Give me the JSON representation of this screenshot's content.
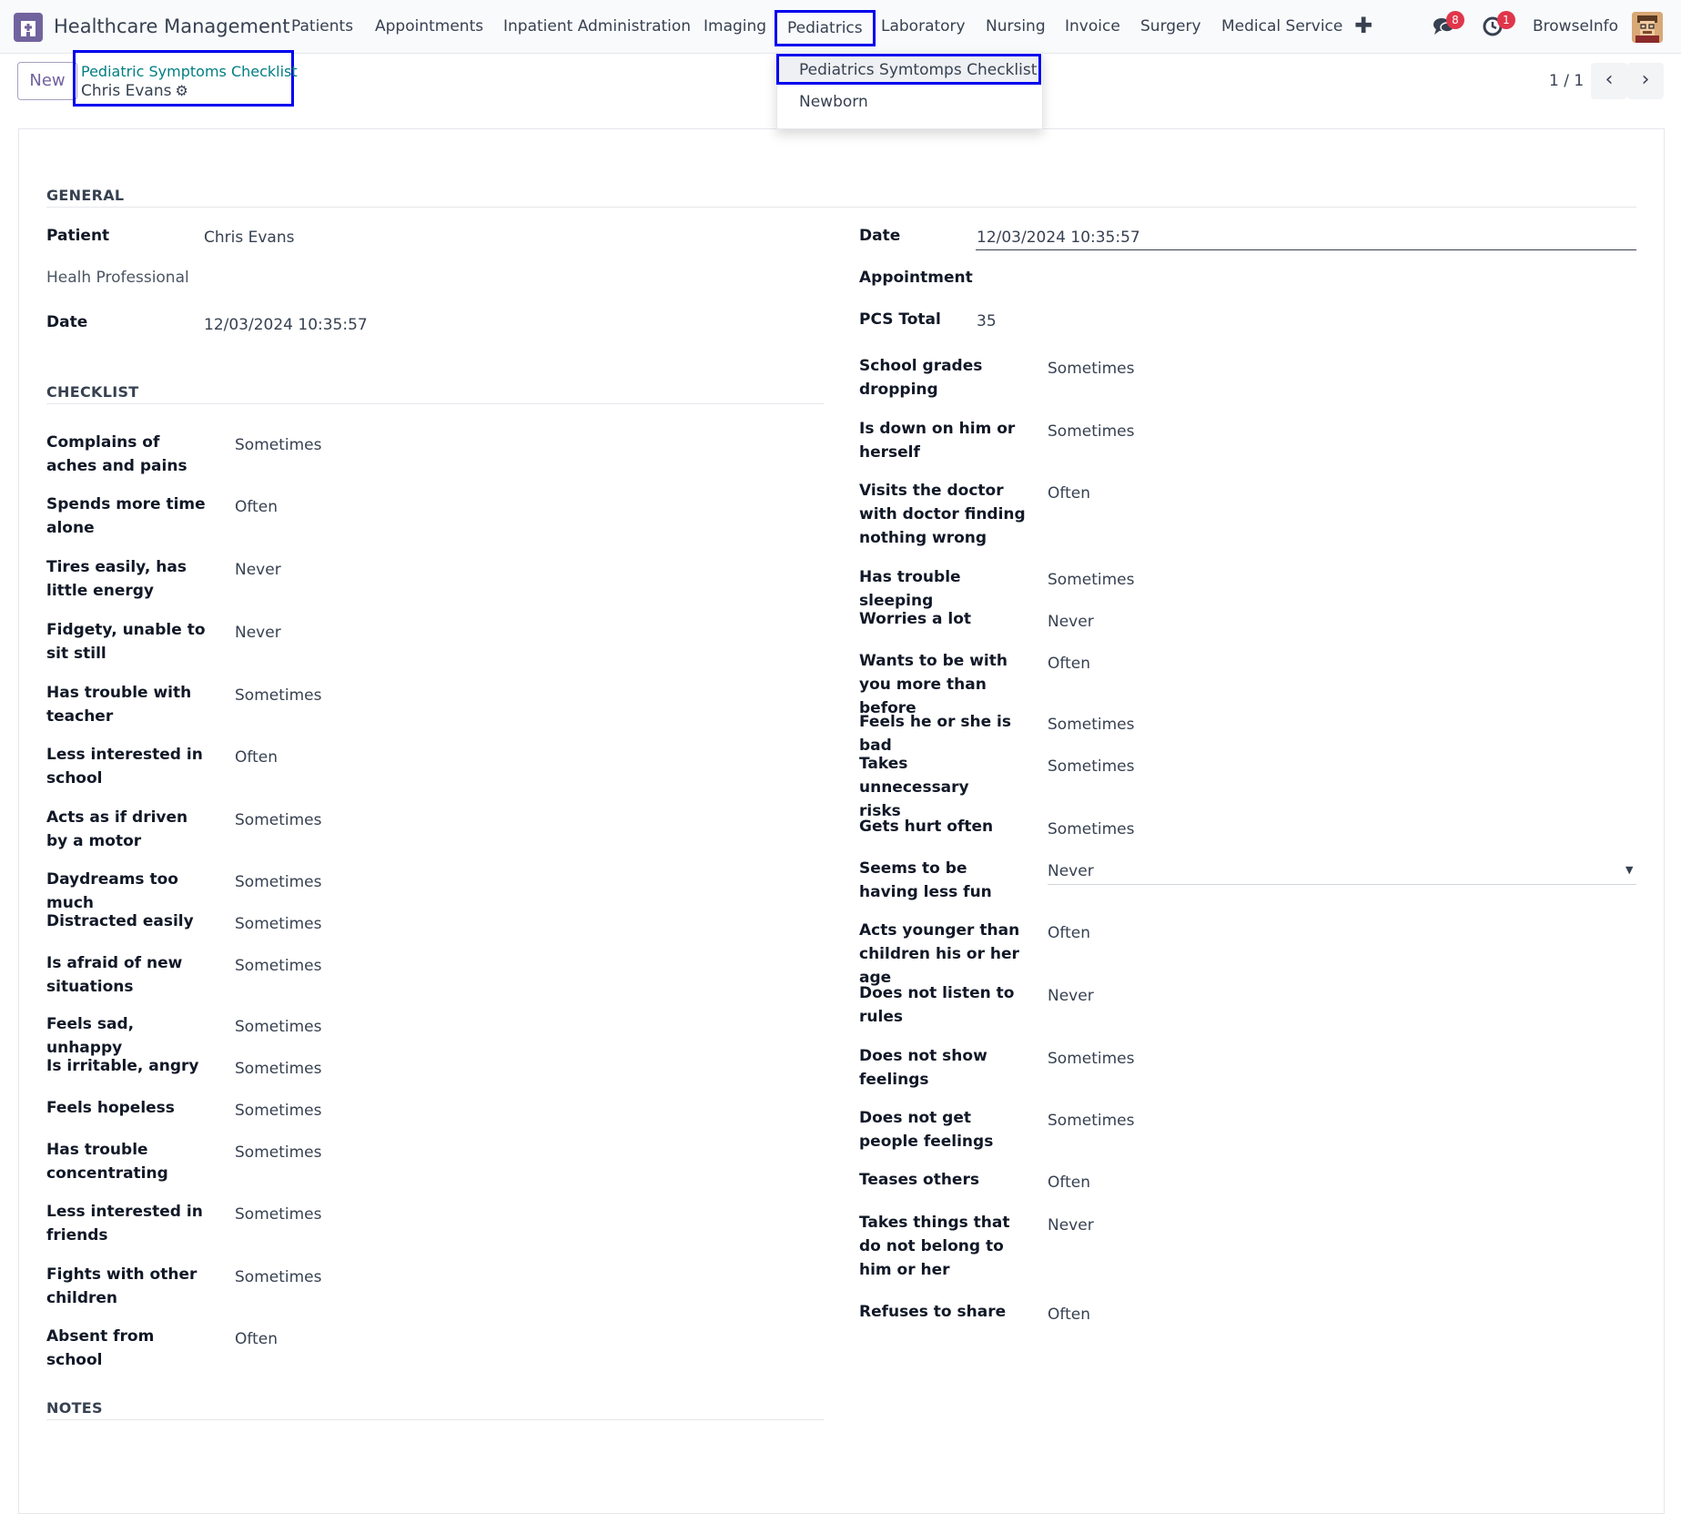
{
  "navbar": {
    "app_title": "Healthcare Management",
    "menu": [
      "Patients",
      "Appointments",
      "Inpatient Administration",
      "Imaging",
      "Pediatrics",
      "Laboratory",
      "Nursing",
      "Invoice",
      "Surgery",
      "Medical Service"
    ],
    "active_menu": "Pediatrics",
    "messages_badge": "8",
    "activities_badge": "1",
    "user_name": "BrowseInfo",
    "icons": [
      "app-icon",
      "plus-icon",
      "chat-icon",
      "clock-icon",
      "avatar"
    ]
  },
  "dropdown": {
    "items": [
      "Pediatrics Symtomps Checklist",
      "Newborn"
    ]
  },
  "control_panel": {
    "new_label": "New",
    "breadcrumb_link": "Pediatric Symptoms Checklist",
    "record_name": "Chris Evans",
    "pager": "1 / 1"
  },
  "form": {
    "general_title": "GENERAL",
    "checklist_title": "CHECKLIST",
    "notes_title": "NOTES",
    "general_left": [
      {
        "label": "Patient",
        "value": "Chris Evans"
      },
      {
        "label": "Healh Professional",
        "value": ""
      },
      {
        "label": "Date",
        "value": "12/03/2024 10:35:57"
      }
    ],
    "general_right": [
      {
        "label": "Date",
        "value": "12/03/2024 10:35:57"
      },
      {
        "label": "Appointment",
        "value": ""
      },
      {
        "label": "PCS Total",
        "value": "35"
      }
    ],
    "checklist_left": [
      {
        "label": "Complains of aches and pains",
        "value": "Sometimes"
      },
      {
        "label": "Spends more time alone",
        "value": "Often"
      },
      {
        "label": "Tires easily, has little energy",
        "value": "Never"
      },
      {
        "label": "Fidgety, unable to sit still",
        "value": "Never"
      },
      {
        "label": "Has trouble with teacher",
        "value": "Sometimes"
      },
      {
        "label": "Less interested in school",
        "value": "Often"
      },
      {
        "label": "Acts as if driven by a motor",
        "value": "Sometimes"
      },
      {
        "label": "Daydreams too much",
        "value": "Sometimes"
      },
      {
        "label": "Distracted easily",
        "value": "Sometimes"
      },
      {
        "label": "Is afraid of new situations",
        "value": "Sometimes"
      },
      {
        "label": "Feels sad, unhappy",
        "value": "Sometimes"
      },
      {
        "label": "Is irritable, angry",
        "value": "Sometimes"
      },
      {
        "label": "Feels hopeless",
        "value": "Sometimes"
      },
      {
        "label": "Has trouble concentrating",
        "value": "Sometimes"
      },
      {
        "label": "Less interested in friends",
        "value": "Sometimes"
      },
      {
        "label": "Fights with other children",
        "value": "Sometimes"
      },
      {
        "label": "Absent from school",
        "value": "Often"
      }
    ],
    "checklist_right": [
      {
        "label": "School grades dropping",
        "value": "Sometimes"
      },
      {
        "label": "Is down on him or herself",
        "value": "Sometimes"
      },
      {
        "label": "Visits the doctor with doctor finding nothing wrong",
        "value": "Often"
      },
      {
        "label": "Has trouble sleeping",
        "value": "Sometimes"
      },
      {
        "label": "Worries a lot",
        "value": "Never"
      },
      {
        "label": "Wants to be with you more than before",
        "value": "Often"
      },
      {
        "label": "Feels he or she is bad",
        "value": "Sometimes"
      },
      {
        "label": "Takes unnecessary risks",
        "value": "Sometimes"
      },
      {
        "label": "Gets hurt often",
        "value": "Sometimes"
      },
      {
        "label": "Seems to be having less fun",
        "value": "Never"
      },
      {
        "label": "Acts younger than children his or her age",
        "value": "Often"
      },
      {
        "label": "Does not listen to rules",
        "value": "Never"
      },
      {
        "label": "Does not show feelings",
        "value": "Sometimes"
      },
      {
        "label": "Does not get people feelings",
        "value": "Sometimes"
      },
      {
        "label": "Teases others",
        "value": "Often"
      },
      {
        "label": "Takes things that do not belong to him or her",
        "value": "Never"
      },
      {
        "label": "Refuses to share",
        "value": "Often"
      }
    ]
  }
}
